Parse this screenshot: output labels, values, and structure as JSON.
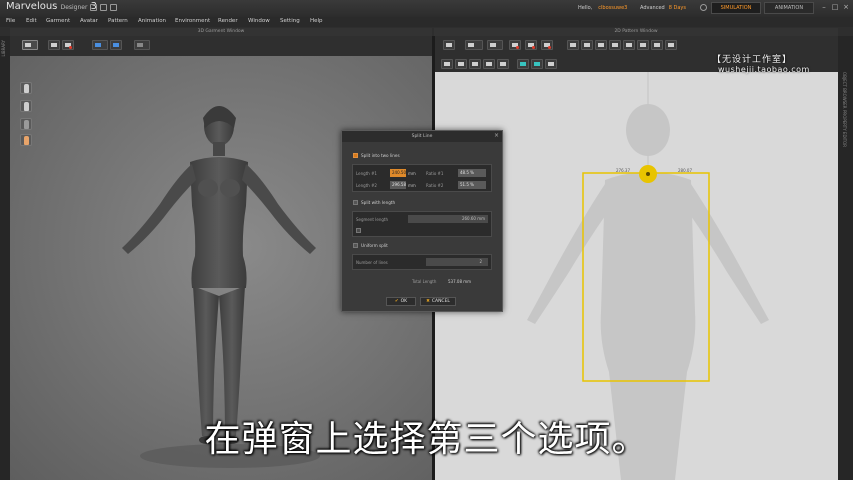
{
  "titlebar": {
    "app_name": "Marvelous",
    "app_sub": "Designer",
    "app_version": "3",
    "hello": "Hello,",
    "user": "clbossuwe3",
    "advanced": "Advanced",
    "days": "8 Days",
    "mode_simulation": "SIMULATION",
    "mode_animation": "ANIMATION"
  },
  "menu": [
    "File",
    "Edit",
    "Garment",
    "Avatar",
    "Pattern",
    "Animation",
    "Environment",
    "Render",
    "Window",
    "Setting",
    "Help"
  ],
  "panels": {
    "left_header": "3D Garment Window",
    "right_header": "2D Pattern Window",
    "left_strip": "LIBRARY",
    "right_strip_1": "OBJECT BROWSER",
    "right_strip_2": "PROPERTY EDITOR"
  },
  "watermark": {
    "line1": "【无设计工作室】",
    "line2": "wushejii.taobao.com"
  },
  "dialog": {
    "title": "Split Line",
    "opt1_label": "Split into two lines",
    "length1_label": "Length #1",
    "length1_value": "240.50",
    "length1_unit": "mm",
    "ratio1_label": "Ratio #1",
    "ratio1_value": "48.5 %",
    "length2_label": "Length #2",
    "length2_value": "296.58",
    "length2_unit": "mm",
    "ratio2_label": "Ratio #2",
    "ratio2_value": "51.5 %",
    "opt2_label": "Split with length",
    "segment_label": "Segment length",
    "segment_value": "260.60 mm",
    "opt3_label": "Uniform split",
    "number_label": "Number of lines",
    "number_value": "2",
    "total_label": "Total Length",
    "total_value": "537.08 mm",
    "ok": "OK",
    "cancel": "CANCEL"
  },
  "pattern": {
    "label_left": "276.37",
    "label_right": "280.07"
  },
  "subtitle": "在弹窗上选择第三个选项。",
  "colors": {
    "accent": "#ff9a2a",
    "selection": "#f0d000",
    "pattern_bg": "#d9d9d9"
  }
}
